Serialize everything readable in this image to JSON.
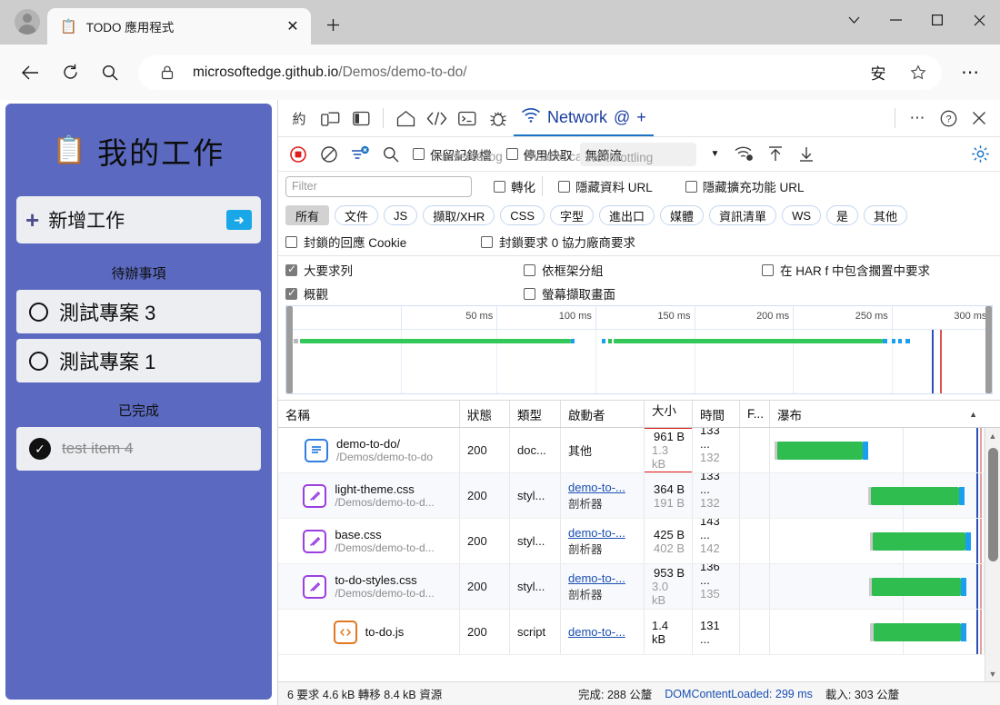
{
  "browser": {
    "tab": {
      "favicon": "clipboard-icon",
      "title": "TODO 應用程式",
      "close": "✕"
    },
    "new_tab_label": "+",
    "window_controls": {
      "more": "⌄",
      "minimize": "—",
      "maximize": "▢",
      "close": "✕"
    },
    "nav": {
      "back": "←",
      "reload": "↻",
      "search": "search-icon"
    },
    "omnibox": {
      "lock": "lock-icon",
      "url_bold": "microsoftedge.github.io",
      "url_rest": "/Demos/demo-to-do/",
      "ime_badge": "安",
      "favorite": "☆"
    },
    "more_button": "⋯"
  },
  "todo_app": {
    "icon": "clipboard-icon",
    "title": "我的工作",
    "add": {
      "plus": "+",
      "label": "新增工作",
      "submit": "➜"
    },
    "sections": [
      {
        "label": "待辦事項",
        "items": [
          {
            "text": "測試專案 3",
            "done": false
          },
          {
            "text": "測試專案 1",
            "done": false
          }
        ]
      },
      {
        "label": "已完成",
        "items": [
          {
            "text": "test item 4",
            "done": true
          }
        ]
      }
    ]
  },
  "devtools": {
    "tabbar": {
      "icons": [
        "約",
        "device-toolbar-icon",
        "dock-side-icon",
        "home-icon",
        "elements-icon",
        "console-icon",
        "debugger-icon"
      ],
      "active_tab": {
        "icon": "network-icon",
        "label": "Network",
        "at": "@",
        "plus": "+"
      },
      "right": {
        "more": "⋯",
        "help": "?",
        "close": "✕"
      }
    },
    "toolbar": {
      "record": "record-stop-icon",
      "clear": "clear-icon",
      "filter": "filter-icon",
      "search": "search-icon",
      "preserve_log": "保留記錄檔",
      "preserve_log_ghost": "Preserve log",
      "disable_cache": "停用快取",
      "disable_cache_ghost": "Disable cache",
      "throttle": "無節流",
      "throttle_ghost": "No throttling",
      "wifi_icon": "network-conditions-icon",
      "import_icon": "import-har-icon",
      "export_icon": "export-har-icon",
      "settings_icon": "gear-icon"
    },
    "filterbar": {
      "placeholder": "Filter",
      "invert": "轉化",
      "hide_data_urls": "隱藏資料 URL",
      "hide_ext_urls": "隱藏擴充功能 URL"
    },
    "type_pills": [
      "所有",
      "文件",
      "JS",
      "擷取/XHR",
      "CSS",
      "字型",
      "進出口",
      "媒體",
      "資訊清單",
      "WS",
      "是",
      "其他"
    ],
    "checkboxes": [
      {
        "label": "封鎖的回應 Cookie",
        "checked": false
      },
      {
        "label": "封鎖要求 0 協力廠商要求",
        "checked": false
      },
      {
        "label": "大要求列",
        "checked": true
      },
      {
        "label": "依框架分組",
        "checked": false
      },
      {
        "label": "在 HAR f 中包含擱置中要求",
        "checked": false
      },
      {
        "label": "概觀",
        "checked": true
      },
      {
        "label": "螢幕擷取畫面",
        "checked": false
      }
    ],
    "overview": {
      "ticks": [
        "50 ms",
        "100 ms",
        "150 ms",
        "200 ms",
        "250 ms",
        "300 ms"
      ]
    },
    "table": {
      "headers": [
        "名稱",
        "狀態",
        "類型",
        "啟動者",
        "大小",
        "時間",
        "F...",
        "瀑布"
      ],
      "rows": [
        {
          "icon": "document-icon",
          "name": "demo-to-do/",
          "path": "/Demos/demo-to-do",
          "status": "200",
          "type": "doc...",
          "initiator": "其他",
          "initiator_sub": "",
          "size": "961 B",
          "size_sub": "1.3 kB",
          "time": "133 ...",
          "time_sub": "132 ...",
          "highlighted": true,
          "wf_start": 2,
          "wf_width": 42
        },
        {
          "icon": "stylesheet-icon",
          "name": "light-theme.css",
          "path": "/Demos/demo-to-d...",
          "status": "200",
          "type": "styl...",
          "initiator": "demo-to-...",
          "initiator_sub": "剖析器",
          "size": "364 B",
          "size_sub": "191 B",
          "time": "133 ...",
          "time_sub": "132 ...",
          "highlighted": false,
          "wf_start": 45,
          "wf_width": 34
        },
        {
          "icon": "stylesheet-icon",
          "name": "base.css",
          "path": "/Demos/demo-to-d...",
          "status": "200",
          "type": "styl...",
          "initiator": "demo-to-...",
          "initiator_sub": "剖析器",
          "size": "425 B",
          "size_sub": "402 B",
          "time": "143 ...",
          "time_sub": "142 ...",
          "highlighted": false,
          "wf_start": 46,
          "wf_width": 38
        },
        {
          "icon": "stylesheet-icon",
          "name": "to-do-styles.css",
          "path": "/Demos/demo-to-d...",
          "status": "200",
          "type": "styl...",
          "initiator": "demo-to-...",
          "initiator_sub": "剖析器",
          "size": "953 B",
          "size_sub": "3.0 kB",
          "time": "136 ...",
          "time_sub": "135 ...",
          "highlighted": false,
          "wf_start": 46,
          "wf_width": 36
        },
        {
          "icon": "script-icon",
          "name": "to-do.js",
          "path": "",
          "status": "200",
          "type": "script",
          "initiator": "demo-to-...",
          "initiator_sub": "",
          "size": "1.4 kB",
          "size_sub": "",
          "time": "131 ...",
          "time_sub": "",
          "highlighted": false,
          "wf_start": 47,
          "wf_width": 36
        }
      ]
    },
    "statusbar": {
      "requests": "6 要求 4.6 kB 轉移 8.4 kB 資源",
      "finish": "完成: 288 公釐",
      "dcl": "DOMContentLoaded: 299 ms",
      "load": "載入: 303 公釐"
    }
  },
  "colors": {
    "todo_bg": "#5b6ac0",
    "accent_blue": "#1a4fb4",
    "waterfall_green": "#2fbd4f",
    "highlight_red": "#e01b1b",
    "tabstrip": "#cdcdcd"
  }
}
